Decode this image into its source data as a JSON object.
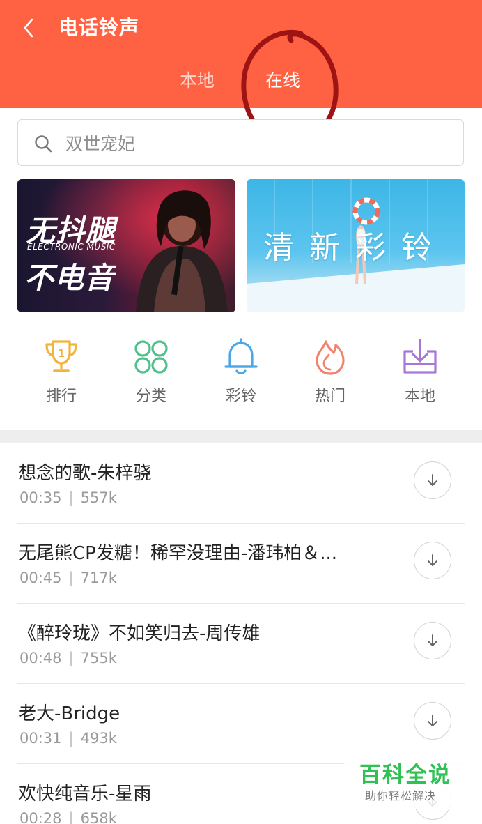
{
  "header": {
    "title": "电话铃声",
    "tabs": [
      {
        "label": "本地",
        "active": false
      },
      {
        "label": "在线",
        "active": true
      }
    ],
    "color": "#ff6243"
  },
  "search": {
    "placeholder": "双世宠妃"
  },
  "banners": [
    {
      "line1": "无抖腿",
      "sub": "ELECTRONIC MUSIC",
      "line2": "不电音"
    },
    {
      "text": "清新彩铃"
    }
  ],
  "categories": [
    {
      "label": "排行",
      "icon": "trophy-icon",
      "color": "#f2b43a",
      "badge": "1"
    },
    {
      "label": "分类",
      "icon": "grid-circles-icon",
      "color": "#4fbf8b"
    },
    {
      "label": "彩铃",
      "icon": "bell-icon",
      "color": "#4aa8e8"
    },
    {
      "label": "热门",
      "icon": "flame-icon",
      "color": "#f0846e"
    },
    {
      "label": "本地",
      "icon": "download-box-icon",
      "color": "#a877d6"
    }
  ],
  "songs": [
    {
      "title": "想念的歌-朱梓骁",
      "duration": "00:35",
      "size": "557k"
    },
    {
      "title": "无尾熊CP发糖！稀罕没理由-潘玮柏＆...",
      "duration": "00:45",
      "size": "717k"
    },
    {
      "title": "《醉玲珑》不如笑归去-周传雄",
      "duration": "00:48",
      "size": "755k"
    },
    {
      "title": "老大-Bridge",
      "duration": "00:31",
      "size": "493k"
    },
    {
      "title": "欢快纯音乐-星雨",
      "duration": "00:28",
      "size": "658k"
    }
  ],
  "watermark": {
    "title": "百科全说",
    "subtitle": "助你轻松解决"
  }
}
